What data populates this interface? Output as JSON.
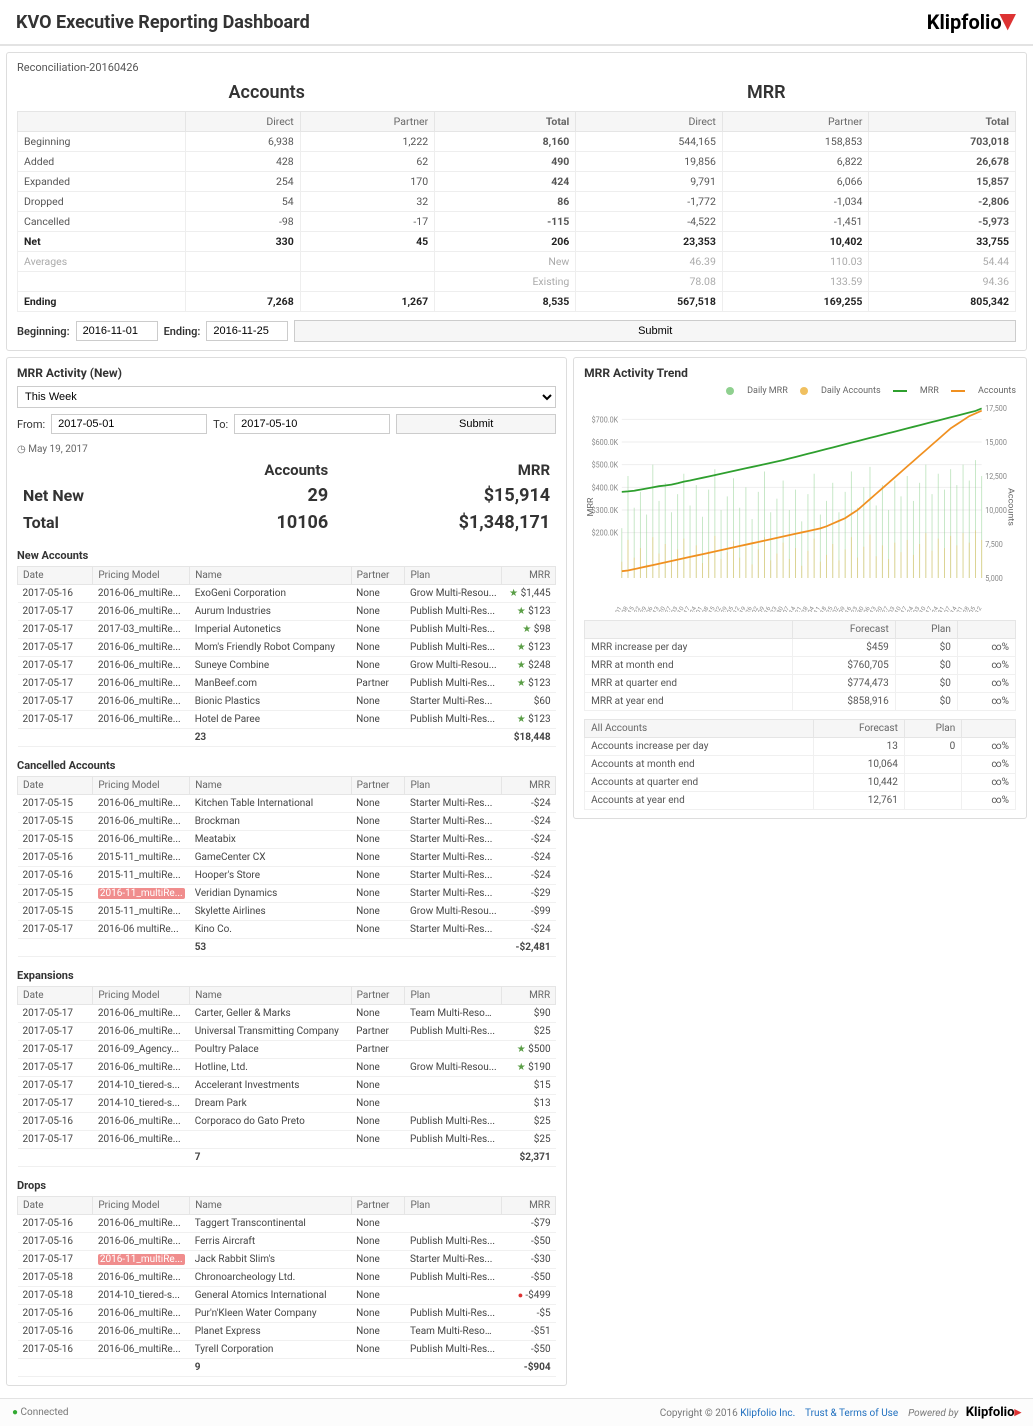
{
  "header": {
    "title": "KVO Executive Reporting Dashboard",
    "brand": "Klipfolio"
  },
  "reconciliation": {
    "subtitle": "Reconciliation-20160426",
    "section_accounts": "Accounts",
    "section_mrr": "MRR",
    "columns": [
      "",
      "Direct",
      "Partner",
      "Total",
      "Direct",
      "Partner",
      "Total"
    ],
    "rows": [
      {
        "label": "Beginning",
        "acc": [
          "6,938",
          "1,222",
          "8,160"
        ],
        "mrr": [
          "544,165",
          "158,853",
          "703,018"
        ],
        "cls": ""
      },
      {
        "label": "Added",
        "acc": [
          "428",
          "62",
          "490"
        ],
        "mrr": [
          "19,856",
          "6,822",
          "26,678"
        ],
        "cls": ""
      },
      {
        "label": "Expanded",
        "acc": [
          "254",
          "170",
          "424"
        ],
        "mrr": [
          "9,791",
          "6,066",
          "15,857"
        ],
        "cls": ""
      },
      {
        "label": "Dropped",
        "acc": [
          "54",
          "32",
          "86"
        ],
        "mrr": [
          "-1,772",
          "-1,034",
          "-2,806"
        ],
        "cls": ""
      },
      {
        "label": "Cancelled",
        "acc": [
          "-98",
          "-17",
          "-115"
        ],
        "mrr": [
          "-4,522",
          "-1,451",
          "-5,973"
        ],
        "cls": ""
      },
      {
        "label": "Net",
        "acc": [
          "330",
          "45",
          "206"
        ],
        "mrr": [
          "23,353",
          "10,402",
          "33,755"
        ],
        "cls": "bold"
      },
      {
        "label": "Averages",
        "acc": [
          "",
          "",
          "New"
        ],
        "mrr": [
          "46.39",
          "110.03",
          "54.44"
        ],
        "cls": "muted"
      },
      {
        "label": "",
        "acc": [
          "",
          "",
          "Existing"
        ],
        "mrr": [
          "78.08",
          "133.59",
          "94.36"
        ],
        "cls": "muted"
      },
      {
        "label": "Ending",
        "acc": [
          "7,268",
          "1,267",
          "8,535"
        ],
        "mrr": [
          "567,518",
          "169,255",
          "805,342"
        ],
        "cls": "bold"
      }
    ],
    "beginning_label": "Beginning:",
    "beginning_value": "2016-11-01",
    "ending_label": "Ending:",
    "ending_value": "2016-11-25",
    "submit": "Submit"
  },
  "activity": {
    "title": "MRR Activity (New)",
    "range": "This Week",
    "from_label": "From:",
    "from_value": "2017-05-01",
    "to_label": "To:",
    "to_value": "2017-05-10",
    "submit": "Submit",
    "asof": "May 19, 2017",
    "summary_cols": [
      "",
      "Accounts",
      "MRR"
    ],
    "summary": [
      {
        "label": "Net New",
        "acc": "29",
        "mrr": "$15,914"
      },
      {
        "label": "Total",
        "acc": "10106",
        "mrr": "$1,348,171"
      }
    ],
    "new_header": "New Accounts",
    "cancelled_header": "Cancelled Accounts",
    "expansions_header": "Expansions",
    "drops_header": "Drops",
    "cols": [
      "Date",
      "Pricing Model",
      "Name",
      "Partner",
      "Plan",
      "MRR"
    ],
    "new_rows": [
      [
        "2017-05-16",
        "2016-06_multiRe...",
        "ExoGeni Corporation",
        "None",
        "Grow Multi-Resou...",
        "$1,445",
        "star"
      ],
      [
        "2017-05-17",
        "2016-06_multiRe...",
        "Aurum Industries",
        "None",
        "Publish Multi-Res...",
        "$123",
        "star"
      ],
      [
        "2017-05-17",
        "2017-03_multiRe...",
        "Imperial Autonetics",
        "None",
        "Publish Multi-Res...",
        "$98",
        "star"
      ],
      [
        "2017-05-17",
        "2016-06_multiRe...",
        "Mom's Friendly Robot Company",
        "None",
        "Publish Multi-Res...",
        "$123",
        "star"
      ],
      [
        "2017-05-17",
        "2016-06_multiRe...",
        "Suneye Combine",
        "None",
        "Grow Multi-Resou...",
        "$248",
        "star"
      ],
      [
        "2017-05-17",
        "2016-06_multiRe...",
        "ManBeef.com",
        "Partner",
        "Publish Multi-Res...",
        "$123",
        "star"
      ],
      [
        "2017-05-17",
        "2016-06_multiRe...",
        "Bionic Plastics",
        "None",
        "Starter Multi-Res...",
        "$60",
        ""
      ],
      [
        "2017-05-17",
        "2016-06_multiRe...",
        "Hotel de Paree",
        "None",
        "Publish Multi-Res...",
        "$123",
        "star"
      ]
    ],
    "new_total": [
      "23",
      "$18,448"
    ],
    "cancelled_rows": [
      [
        "2017-05-15",
        "2016-06_multiRe...",
        "Kitchen Table International",
        "None",
        "Starter Multi-Res...",
        "-$24",
        ""
      ],
      [
        "2017-05-15",
        "2016-06_multiRe...",
        "Brockman",
        "None",
        "Starter Multi-Res...",
        "-$24",
        ""
      ],
      [
        "2017-05-15",
        "2016-06_multiRe...",
        "Meatabix",
        "None",
        "Starter Multi-Res...",
        "-$24",
        ""
      ],
      [
        "2017-05-16",
        "2015-11_multiRe...",
        "GameCenter CX",
        "None",
        "Starter Multi-Res...",
        "-$24",
        ""
      ],
      [
        "2017-05-16",
        "2015-11_multiRe...",
        "Hooper's Store",
        "None",
        "Starter Multi-Res...",
        "-$24",
        ""
      ],
      [
        "2017-05-15",
        "2016-11_multiRe...",
        "Veridian Dynamics",
        "None",
        "Starter Multi-Res...",
        "-$29",
        "hl"
      ],
      [
        "2017-05-15",
        "2015-11_multiRe...",
        "Skylette Airlines",
        "None",
        "Grow Multi-Resou...",
        "-$99",
        ""
      ],
      [
        "2017-05-17",
        "2016-06 multiRe...",
        "Kino Co.",
        "None",
        "Starter Multi-Res...",
        "-$24",
        ""
      ]
    ],
    "cancelled_total": [
      "53",
      "-$2,481"
    ],
    "exp_rows": [
      [
        "2017-05-17",
        "2016-06_multiRe...",
        "Carter, Geller & Marks",
        "None",
        "Team Multi-Resou...",
        "$90",
        ""
      ],
      [
        "2017-05-17",
        "2016-06_multiRe...",
        "Universal Transmitting Company",
        "Partner",
        "Publish Multi-Res...",
        "$25",
        ""
      ],
      [
        "2017-05-17",
        "2016-09_Agency...",
        "Poultry Palace",
        "Partner",
        "",
        "$500",
        "star"
      ],
      [
        "2017-05-17",
        "2016-06_multiRe...",
        "Hotline, Ltd.",
        "None",
        "Grow Multi-Resou...",
        "$190",
        "star"
      ],
      [
        "2017-05-17",
        "2014-10_tiered-s...",
        "Accelerant Investments",
        "None",
        "",
        "$15",
        ""
      ],
      [
        "2017-05-17",
        "2014-10_tiered-s...",
        "Dream Park",
        "None",
        "",
        "$13",
        ""
      ],
      [
        "2017-05-16",
        "2016-06_multiRe...",
        "Corporaco do Gato Preto",
        "None",
        "Publish Multi-Res...",
        "$25",
        ""
      ],
      [
        "2017-05-17",
        "2016-06_multiRe...",
        "",
        "None",
        "Publish Multi-Res...",
        "$25",
        ""
      ]
    ],
    "exp_total": [
      "7",
      "$2,371"
    ],
    "drop_rows": [
      [
        "2017-05-16",
        "2016-06_multiRe...",
        "Taggert Transcontinental",
        "None",
        "",
        "-$79",
        ""
      ],
      [
        "2017-05-16",
        "2016-06_multiRe...",
        "Ferris Aircraft",
        "None",
        "Publish Multi-Res...",
        "-$50",
        ""
      ],
      [
        "2017-05-17",
        "2016-11_multiRe...",
        "Jack Rabbit Slim's",
        "None",
        "Starter Multi-Res...",
        "-$30",
        "hl"
      ],
      [
        "2017-05-18",
        "2016-06_multiRe...",
        "Chronoarcheology Ltd.",
        "None",
        "Publish Multi-Res...",
        "-$50",
        ""
      ],
      [
        "2017-05-18",
        "2014-10_tiered-s...",
        "General Atomics International",
        "None",
        "",
        "-$499",
        "warn"
      ],
      [
        "2017-05-16",
        "2016-06_multiRe...",
        "Pur'n'Kleen Water Company",
        "None",
        "Publish Multi-Res...",
        "-$5",
        ""
      ],
      [
        "2017-05-16",
        "2016-06_multiRe...",
        "Planet Express",
        "None",
        "Team Multi-Resou...",
        "-$51",
        ""
      ],
      [
        "2017-05-16",
        "2016-06_multiRe...",
        "Tyrell Corporation",
        "None",
        "Publish Multi-Res...",
        "-$50",
        ""
      ]
    ],
    "drop_total": [
      "9",
      "-$904"
    ]
  },
  "trend": {
    "title": "MRR Activity Trend",
    "legend": [
      "Daily MRR",
      "Daily Accounts",
      "MRR",
      "Accounts"
    ],
    "legend_colors": [
      "#8fd08f",
      "#f0c060",
      "#2e9f2e",
      "#f09020"
    ],
    "y_left_label": "MRR",
    "y_right_label": "Accounts",
    "forecast_cols": [
      "",
      "Forecast",
      "Plan",
      ""
    ],
    "forecast_mrr": [
      [
        "MRR increase per day",
        "$459",
        "$0",
        "∞%"
      ],
      [
        "MRR at month end",
        "$760,705",
        "$0",
        "∞%"
      ],
      [
        "MRR at quarter end",
        "$774,473",
        "$0",
        "∞%"
      ],
      [
        "MRR at year end",
        "$858,916",
        "$0",
        "∞%"
      ]
    ],
    "forecast_acc_cols": [
      "All Accounts",
      "Forecast",
      "Plan",
      ""
    ],
    "forecast_acc": [
      [
        "Accounts increase per day",
        "13",
        "0",
        "∞%"
      ],
      [
        "Accounts at month end",
        "10,064",
        "",
        "∞%"
      ],
      [
        "Accounts at quarter end",
        "10,442",
        "",
        "∞%"
      ],
      [
        "Accounts at year end",
        "12,761",
        "",
        "∞%"
      ]
    ]
  },
  "chart_data": {
    "type": "line",
    "title": "MRR Activity Trend",
    "y_left": {
      "label": "MRR",
      "lim": [
        0,
        750000
      ],
      "ticks": [
        "$200.0K",
        "$300.0K",
        "$400.0K",
        "$500.0K",
        "$600.0K",
        "$700.0K"
      ]
    },
    "y_right": {
      "label": "Accounts",
      "lim": [
        5000,
        17500
      ],
      "ticks": [
        "5,000",
        "7,500",
        "10,000",
        "12,500",
        "15,000",
        "17,500"
      ]
    },
    "x_ticks": [
      "Apr 01",
      "Apr 08",
      "Apr 15",
      "Apr 22",
      "Apr 29",
      "May 06",
      "May 13",
      "May 20",
      "May 27",
      "Jun 03",
      "Jun 10",
      "Jun 17",
      "Jun 24",
      "Jul 01",
      "Jul 08",
      "Jul 15",
      "Jul 22",
      "Jul 29",
      "Aug 05",
      "Aug 12",
      "Aug 19",
      "Aug 26",
      "Sep 02",
      "Sep 09",
      "Sep 16",
      "Sep 23",
      "Sep 30",
      "Oct 07",
      "Oct 14",
      "Oct 21",
      "Oct 28",
      "Nov 04",
      "Nov 11",
      "Nov 18",
      "Nov 25",
      "Dec 02",
      "Dec 09",
      "Dec 16",
      "Dec 23",
      "Dec 30",
      "Jan 06",
      "Jan 13",
      "Jan 20",
      "Jan 27",
      "Feb 03",
      "Feb 10",
      "Feb 17",
      "Feb 24",
      "Mar 03",
      "Mar 10",
      "Mar 17",
      "Mar 24",
      "Mar 31",
      "Apr 07",
      "Apr 14",
      "Apr 21",
      "Apr 28",
      "May 05",
      "May 12"
    ],
    "series": [
      {
        "name": "MRR",
        "color": "#2e9f2e",
        "axis": "left",
        "values": [
          380000,
          382000,
          385000,
          390000,
          395000,
          400000,
          405000,
          408000,
          412000,
          418000,
          425000,
          430000,
          436000,
          442000,
          448000,
          454000,
          460000,
          466000,
          472000,
          478000,
          484000,
          490000,
          496000,
          502000,
          508000,
          514000,
          520000,
          527000,
          534000,
          541000,
          548000,
          555000,
          562000,
          569000,
          576000,
          583000,
          590000,
          597000,
          604000,
          611000,
          618000,
          625000,
          632000,
          639000,
          646000,
          653000,
          660000,
          667000,
          674000,
          681000,
          688000,
          695000,
          702000,
          709000,
          716000,
          723000,
          730000,
          737000,
          748000
        ]
      },
      {
        "name": "Accounts",
        "color": "#f09020",
        "axis": "right",
        "values": [
          5500,
          5550,
          5650,
          5750,
          5850,
          5950,
          6050,
          6150,
          6250,
          6350,
          6450,
          6550,
          6650,
          6750,
          6850,
          6950,
          7050,
          7150,
          7250,
          7350,
          7450,
          7550,
          7650,
          7750,
          7850,
          7950,
          8050,
          8150,
          8250,
          8350,
          8450,
          8550,
          8650,
          8800,
          9000,
          9200,
          9400,
          9700,
          10000,
          10400,
          10800,
          11200,
          11600,
          12000,
          12400,
          12800,
          13200,
          13600,
          14000,
          14400,
          14800,
          15200,
          15600,
          16000,
          16300,
          16600,
          16900,
          17100,
          17300
        ]
      },
      {
        "name": "Daily MRR",
        "color": "#8fd08f",
        "axis": "left",
        "style": "bar",
        "values": [
          220000,
          450000,
          310000,
          380000,
          280000,
          500000,
          340000,
          420000,
          290000,
          370000,
          460000,
          320000,
          410000,
          270000,
          390000,
          480000,
          300000,
          360000,
          440000,
          310000,
          400000,
          260000,
          380000,
          470000,
          290000,
          350000,
          430000,
          300000,
          390000,
          250000,
          370000,
          460000,
          280000,
          340000,
          420000,
          290000,
          380000,
          470000,
          310000,
          400000,
          490000,
          320000,
          410000,
          300000,
          430000,
          360000,
          450000,
          340000,
          420000,
          500000,
          370000,
          460000,
          390000,
          480000,
          410000,
          500000,
          430000,
          520000,
          450000
        ]
      },
      {
        "name": "Daily Accounts",
        "color": "#f0c060",
        "axis": "right",
        "style": "bar",
        "values": [
          6200,
          7800,
          6500,
          7200,
          6000,
          8000,
          6800,
          7500,
          6300,
          7100,
          7900,
          6600,
          7400,
          6100,
          7000,
          8100,
          6400,
          6900,
          7700,
          6500,
          7300,
          6000,
          7100,
          8000,
          6300,
          6800,
          7600,
          6400,
          7200,
          5900,
          7000,
          7900,
          6200,
          6700,
          7500,
          6300,
          7100,
          8000,
          6500,
          7300,
          8200,
          6600,
          7400,
          6400,
          7600,
          6900,
          7800,
          6700,
          7500,
          8300,
          7000,
          7900,
          7200,
          8100,
          7400,
          8300,
          7600,
          8500,
          7800
        ]
      }
    ]
  },
  "footer": {
    "connected": "Connected",
    "copyright": "Copyright © 2016",
    "company": "Klipfolio Inc.",
    "trust": "Trust & Terms of Use",
    "powered": "Powered by",
    "brand": "Klipfolio"
  }
}
